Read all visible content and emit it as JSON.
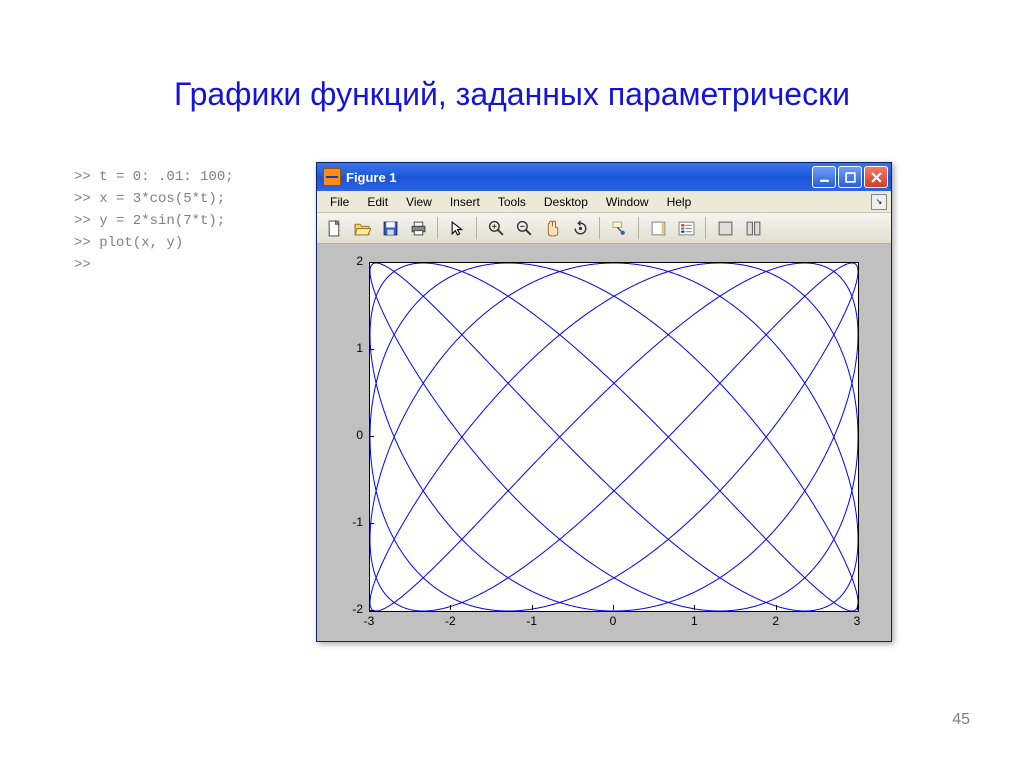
{
  "slide": {
    "title": "Графики функций, заданных параметрически",
    "page_number": "45"
  },
  "code": {
    "l1": ">> t = 0: .01: 100;",
    "l2": ">> x = 3*cos(5*t);",
    "l3": ">> y = 2*sin(7*t);",
    "l4": ">> plot(x, y)",
    "l5": ">>"
  },
  "window": {
    "title": "Figure 1",
    "menus": [
      "File",
      "Edit",
      "View",
      "Insert",
      "Tools",
      "Desktop",
      "Window",
      "Help"
    ]
  },
  "toolbar": {
    "icons": [
      "new-icon",
      "open-icon",
      "save-icon",
      "print-icon",
      "sep",
      "pointer-icon",
      "sep",
      "zoom-in-icon",
      "zoom-out-icon",
      "pan-icon",
      "rotate-icon",
      "sep",
      "data-cursor-icon",
      "sep",
      "colorbar-icon",
      "legend-icon",
      "sep",
      "hide-tools-icon",
      "show-tools-icon"
    ]
  },
  "chart_data": {
    "type": "line",
    "title": "",
    "xlabel": "",
    "ylabel": "",
    "xlim": [
      -3,
      3
    ],
    "ylim": [
      -2,
      2
    ],
    "xticks": [
      -3,
      -2,
      -1,
      0,
      1,
      2,
      3
    ],
    "yticks": [
      -2,
      -1,
      0,
      1,
      2
    ],
    "parametric": {
      "t_start": 0,
      "t_end": 100,
      "t_step": 0.01,
      "x_expr": "3*cos(5*t)",
      "y_expr": "2*sin(7*t)"
    },
    "line_color": "#0000ff"
  }
}
